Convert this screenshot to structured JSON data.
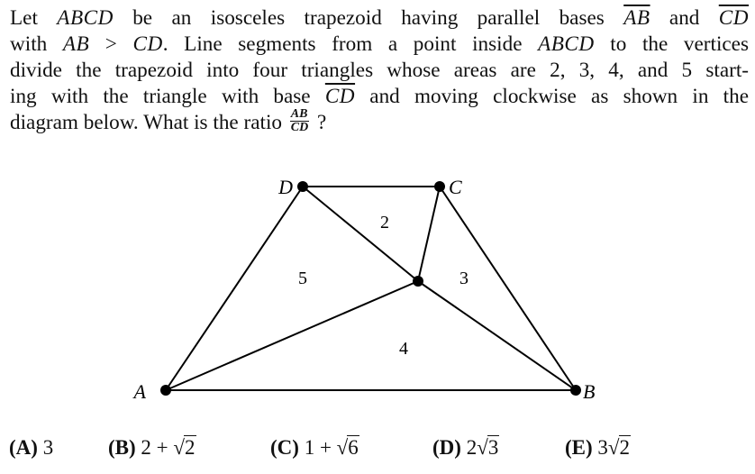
{
  "problem": {
    "lines": [
      [
        {
          "t": "Let ",
          "s": "text"
        },
        {
          "t": "ABCD",
          "s": "math"
        },
        {
          "t": " be an isosceles trapezoid having parallel bases ",
          "s": "text"
        },
        {
          "t": "AB",
          "s": "math-overline"
        },
        {
          "t": " and ",
          "s": "text"
        },
        {
          "t": "CD",
          "s": "math-overline"
        }
      ],
      [
        {
          "t": "with ",
          "s": "text"
        },
        {
          "t": "AB",
          "s": "math"
        },
        {
          "t": " > ",
          "s": "text"
        },
        {
          "t": "CD",
          "s": "math"
        },
        {
          "t": ". Line segments from a point inside ",
          "s": "text"
        },
        {
          "t": "ABCD",
          "s": "math"
        },
        {
          "t": " to the vertices",
          "s": "text"
        }
      ],
      [
        {
          "t": "divide the trapezoid into four triangles whose areas are 2, 3, 4, and 5 start-",
          "s": "text"
        }
      ],
      [
        {
          "t": "ing with the triangle with base ",
          "s": "text"
        },
        {
          "t": "CD",
          "s": "math-overline"
        },
        {
          "t": " and moving clockwise as shown in the",
          "s": "text"
        }
      ],
      [
        {
          "t": "diagram below. What is the ratio ",
          "s": "text"
        },
        {
          "t": "AB/CD",
          "s": "fraction",
          "num": "AB",
          "den": "CD"
        },
        {
          "t": " ?",
          "s": "text"
        }
      ]
    ]
  },
  "diagram": {
    "vertices": [
      {
        "label": "A",
        "role": "bottom-left vertex of base AB"
      },
      {
        "label": "B",
        "role": "bottom-right vertex of base AB"
      },
      {
        "label": "C",
        "role": "top-right vertex of base CD"
      },
      {
        "label": "D",
        "role": "top-left vertex of base CD"
      },
      {
        "label": "",
        "role": "interior point P"
      }
    ],
    "region_labels": [
      {
        "text": "2",
        "triangle": "PCD"
      },
      {
        "text": "3",
        "triangle": "PBC"
      },
      {
        "text": "4",
        "triangle": "PAB"
      },
      {
        "text": "5",
        "triangle": "PDA"
      }
    ]
  },
  "choices": [
    {
      "letter": "(A)",
      "value": "3"
    },
    {
      "letter": "(B)",
      "prefix": "2 + ",
      "sqrt": "2"
    },
    {
      "letter": "(C)",
      "prefix": "1 + ",
      "sqrt": "6"
    },
    {
      "letter": "(D)",
      "prefix": "2",
      "sqrt": "3"
    },
    {
      "letter": "(E)",
      "prefix": "3",
      "sqrt": "2"
    }
  ]
}
